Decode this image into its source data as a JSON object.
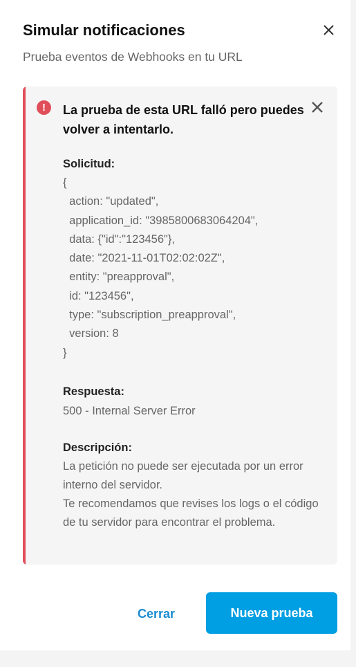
{
  "modal": {
    "title": "Simular notificaciones",
    "subtitle": "Prueba eventos de Webhooks en tu URL",
    "close_icon": "close-icon"
  },
  "alert": {
    "icon": "error-icon",
    "icon_glyph": "!",
    "title": "La prueba de esta URL falló pero puedes volver a intentarlo.",
    "request_label": "Solicitud:",
    "request_body": "{\n  action: \"updated\",\n  application_id: \"3985800683064204\",\n  data: {\"id\":\"123456\"},\n  date: \"2021-11-01T02:02:02Z\",\n  entity: \"preapproval\",\n  id: \"123456\",\n  type: \"subscription_preapproval\",\n  version: 8\n}",
    "response_label": "Respuesta:",
    "response_value": "500 - Internal Server Error",
    "description_label": "Descripción:",
    "description_1": "La petición no puede ser ejecutada por un error interno del servidor.",
    "description_2": "Te recomendamos que revises los logs o el código de tu servidor para encontrar el problema.",
    "accent_color": "#e04e5a"
  },
  "footer": {
    "close_label": "Cerrar",
    "retry_label": "Nueva prueba",
    "primary_color": "#009ee3"
  }
}
